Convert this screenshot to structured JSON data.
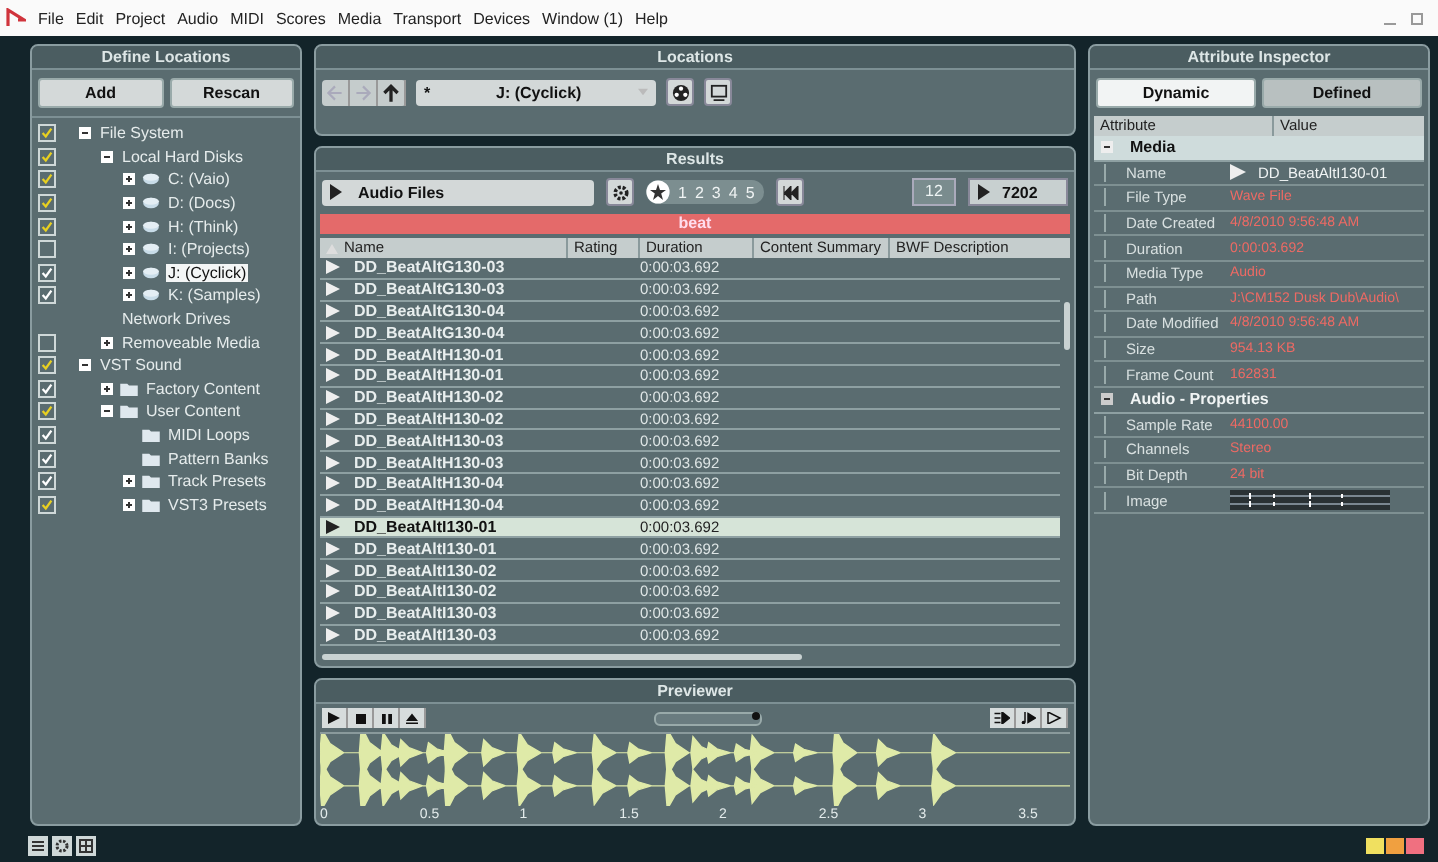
{
  "menu": [
    "File",
    "Edit",
    "Project",
    "Audio",
    "MIDI",
    "Scores",
    "Media",
    "Transport",
    "Devices",
    "Window (1)",
    "Help"
  ],
  "define_locations": {
    "title": "Define Locations",
    "buttons": [
      "Add",
      "Rescan"
    ],
    "tree": [
      {
        "label": "File System",
        "checked": true,
        "color": "#e8d020",
        "expanded": true,
        "selected": false,
        "children": [
          {
            "label": "Local Hard Disks",
            "checked": true,
            "color": "#e8d020",
            "expanded": true,
            "selected": false,
            "children": [
              {
                "label": "C: (Vaio)",
                "kind": "disk",
                "checked": true,
                "color": "#e8d020",
                "expanded": false,
                "selected": false
              },
              {
                "label": "D: (Docs)",
                "kind": "disk",
                "checked": true,
                "color": "#e8d020",
                "expanded": false,
                "selected": false
              },
              {
                "label": "H: (Think)",
                "kind": "disk",
                "checked": true,
                "color": "#e8d020",
                "expanded": false,
                "selected": false
              },
              {
                "label": "I: (Projects)",
                "kind": "disk",
                "checked": false,
                "expanded": false,
                "selected": false
              },
              {
                "label": "J: (Cyclick)",
                "kind": "disk",
                "checked": true,
                "color": "#ffffff",
                "expanded": false,
                "selected": true
              },
              {
                "label": "K: (Samples)",
                "kind": "disk",
                "checked": true,
                "color": "#ffffff",
                "expanded": false,
                "selected": false
              }
            ]
          },
          {
            "label": "Network Drives",
            "selected": false
          },
          {
            "label": "Removeable Media",
            "checked": false,
            "expanded": false,
            "selected": false
          }
        ]
      },
      {
        "label": "VST Sound",
        "checked": true,
        "color": "#e8d020",
        "expanded": true,
        "selected": false,
        "children": [
          {
            "label": "Factory Content",
            "kind": "folder",
            "checked": true,
            "color": "#ffffff",
            "expanded": false,
            "selected": false
          },
          {
            "label": "User Content",
            "kind": "folder",
            "checked": true,
            "color": "#e8d020",
            "expanded": true,
            "selected": false,
            "children": [
              {
                "label": "MIDI Loops",
                "kind": "folder",
                "checked": true,
                "color": "#ffffff",
                "selected": false
              },
              {
                "label": "Pattern Banks",
                "kind": "folder",
                "checked": true,
                "color": "#ffffff",
                "selected": false
              },
              {
                "label": "Track Presets",
                "kind": "folder",
                "checked": true,
                "color": "#ffffff",
                "expanded": false,
                "selected": false
              },
              {
                "label": "VST3 Presets",
                "kind": "folder",
                "checked": true,
                "color": "#e8d020",
                "expanded": false,
                "selected": false
              }
            ]
          }
        ]
      }
    ]
  },
  "locations": {
    "title": "Locations",
    "prefix": "*",
    "path": "J: (Cyclick)"
  },
  "results": {
    "title": "Results",
    "media_type": "Audio Files",
    "ratings": [
      "1",
      "2",
      "3",
      "4",
      "5"
    ],
    "page": "12",
    "count": "7202",
    "search": "beat",
    "columns": [
      "Name",
      "Rating",
      "Duration",
      "Content Summary",
      "BWF Description"
    ],
    "rows": [
      {
        "name": "DD_BeatAltG130-03",
        "duration": "0:00:03.692",
        "selected": false
      },
      {
        "name": "DD_BeatAltG130-03",
        "duration": "0:00:03.692",
        "selected": false
      },
      {
        "name": "DD_BeatAltG130-04",
        "duration": "0:00:03.692",
        "selected": false
      },
      {
        "name": "DD_BeatAltG130-04",
        "duration": "0:00:03.692",
        "selected": false
      },
      {
        "name": "DD_BeatAltH130-01",
        "duration": "0:00:03.692",
        "selected": false
      },
      {
        "name": "DD_BeatAltH130-01",
        "duration": "0:00:03.692",
        "selected": false
      },
      {
        "name": "DD_BeatAltH130-02",
        "duration": "0:00:03.692",
        "selected": false
      },
      {
        "name": "DD_BeatAltH130-02",
        "duration": "0:00:03.692",
        "selected": false
      },
      {
        "name": "DD_BeatAltH130-03",
        "duration": "0:00:03.692",
        "selected": false
      },
      {
        "name": "DD_BeatAltH130-03",
        "duration": "0:00:03.692",
        "selected": false
      },
      {
        "name": "DD_BeatAltH130-04",
        "duration": "0:00:03.692",
        "selected": false
      },
      {
        "name": "DD_BeatAltH130-04",
        "duration": "0:00:03.692",
        "selected": false
      },
      {
        "name": "DD_BeatAltI130-01",
        "duration": "0:00:03.692",
        "selected": true
      },
      {
        "name": "DD_BeatAltI130-01",
        "duration": "0:00:03.692",
        "selected": false
      },
      {
        "name": "DD_BeatAltI130-02",
        "duration": "0:00:03.692",
        "selected": false
      },
      {
        "name": "DD_BeatAltI130-02",
        "duration": "0:00:03.692",
        "selected": false
      },
      {
        "name": "DD_BeatAltI130-03",
        "duration": "0:00:03.692",
        "selected": false
      },
      {
        "name": "DD_BeatAltI130-03",
        "duration": "0:00:03.692",
        "selected": false
      }
    ]
  },
  "previewer": {
    "title": "Previewer",
    "level": 0.97,
    "ruler": [
      "0",
      "0.5",
      "1",
      "1.5",
      "2",
      "2.5",
      "3",
      "3.5"
    ]
  },
  "attribute_inspector": {
    "title": "Attribute Inspector",
    "tabs": [
      {
        "label": "Dynamic",
        "selected": true
      },
      {
        "label": "Defined",
        "selected": false
      }
    ],
    "columns": [
      "Attribute",
      "Value"
    ],
    "groups": [
      {
        "title": "Media",
        "expanded": true,
        "selected": true,
        "rows": [
          {
            "name": "Name",
            "kind": "name",
            "value": "DD_BeatAltI130-01"
          },
          {
            "name": "File Type",
            "kind": "text",
            "value": "Wave File"
          },
          {
            "name": "Date Created",
            "kind": "text",
            "value": "4/8/2010 9:56:48 AM"
          },
          {
            "name": "Duration",
            "kind": "text",
            "value": "0:00:03.692"
          },
          {
            "name": "Media Type",
            "kind": "text",
            "value": "Audio"
          },
          {
            "name": "Path",
            "kind": "text",
            "value": "J:\\CM152 Dusk Dub\\Audio\\"
          },
          {
            "name": "Date Modified",
            "kind": "text",
            "value": "4/8/2010 9:56:48 AM"
          },
          {
            "name": "Size",
            "kind": "text",
            "value": "954.13 KB"
          },
          {
            "name": "Frame Count",
            "kind": "text",
            "value": "162831"
          }
        ]
      },
      {
        "title": "Audio - Properties",
        "expanded": true,
        "selected": false,
        "rows": [
          {
            "name": "Sample Rate",
            "kind": "text",
            "value": "44100.00"
          },
          {
            "name": "Channels",
            "kind": "text",
            "value": "Stereo"
          },
          {
            "name": "Bit Depth",
            "kind": "text",
            "value": "24 bit"
          },
          {
            "name": "Image",
            "kind": "image"
          }
        ]
      }
    ]
  }
}
